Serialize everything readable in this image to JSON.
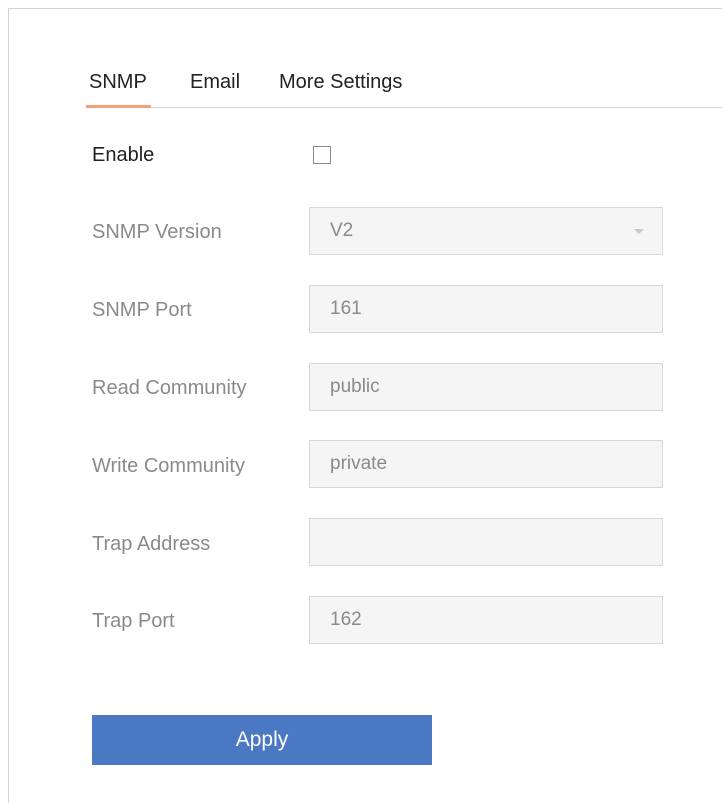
{
  "tabs": [
    {
      "label": "SNMP",
      "active": true
    },
    {
      "label": "Email",
      "active": false
    },
    {
      "label": "More Settings",
      "active": false
    }
  ],
  "form": {
    "enable": {
      "label": "Enable",
      "checked": false
    },
    "snmp_version": {
      "label": "SNMP Version",
      "value": "V2"
    },
    "snmp_port": {
      "label": "SNMP Port",
      "value": "161"
    },
    "read_community": {
      "label": "Read Community",
      "value": "public"
    },
    "write_community": {
      "label": "Write Community",
      "value": "private"
    },
    "trap_address": {
      "label": "Trap Address",
      "value": ""
    },
    "trap_port": {
      "label": "Trap Port",
      "value": "162"
    }
  },
  "apply_label": "Apply",
  "colors": {
    "accent_underline": "#f0a37a",
    "apply_button": "#4a78c2"
  }
}
